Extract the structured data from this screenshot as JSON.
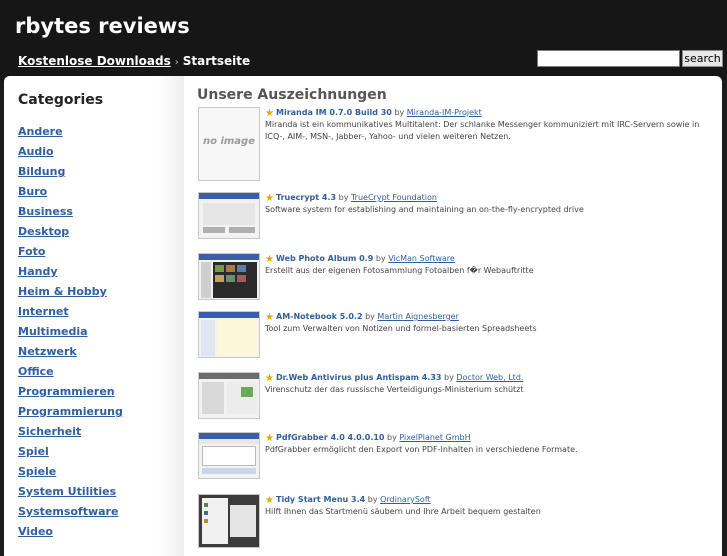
{
  "header": {
    "site_title": "rbytes reviews",
    "breadcrumb": {
      "link": "Kostenlose Downloads",
      "separator": "›",
      "current": "Startseite"
    },
    "search": {
      "placeholder": "",
      "button_label": "search"
    }
  },
  "sidebar": {
    "title": "Categories",
    "items": [
      "Andere",
      "Audio",
      "Bildung",
      "Buro",
      "Business",
      "Desktop",
      "Foto",
      "Handy",
      "Heim & Hobby",
      "Internet",
      "Multimedia",
      "Netzwerk",
      "Office",
      "Programmieren",
      "Programmierung",
      "Sicherheit",
      "Spiel",
      "Spiele",
      "System Utilities",
      "Systemsoftware",
      "Video"
    ]
  },
  "main": {
    "title": "Unsere Auszeichnungen",
    "no_image_text": "no image",
    "by_word": "by",
    "entries": [
      {
        "name": "Miranda IM 0.7.0 Build 30",
        "author": "Miranda-IM-Projekt",
        "description": "Miranda ist ein kommunikatives Multitalent: Der schlanke Messenger kommuniziert mit IRC-Servern sowie in ICQ-, AIM-, MSN-, Jabber-, Yahoo- und vielen weiteren Netzen."
      },
      {
        "name": "Truecrypt 4.3",
        "author": "TrueCrypt Foundation",
        "description": "Software system for establishing and maintaining an on-the-fly-encrypted drive"
      },
      {
        "name": "Web Photo Album 0.9",
        "author": "VicMan Software",
        "description": "Erstellt aus der eigenen Fotosammlung Fotoalben f�r Webauftritte"
      },
      {
        "name": "AM-Notebook 5.0.2",
        "author": "Martin Aignesberger",
        "description": "Tool zum Verwalten von Notizen und formel-basierten Spreadsheets"
      },
      {
        "name": "Dr.Web Antivirus plus Antispam 4.33",
        "author": "Doctor Web, Ltd.",
        "description": "Virenschutz der das russische Verteidigungs-Ministerium schützt"
      },
      {
        "name": "PdfGrabber 4.0 4.0.0.10",
        "author": "PixelPlanet GmbH",
        "description": "PdfGrabber ermöglicht den Export von PDF-Inhalten in verschiedene Formate."
      },
      {
        "name": "Tidy Start Menu 3.4",
        "author": "OrdinarySoft",
        "description": "Hilft Ihnen das Startmenü säubern und Ihre Arbeit bequem gestalten"
      }
    ]
  }
}
